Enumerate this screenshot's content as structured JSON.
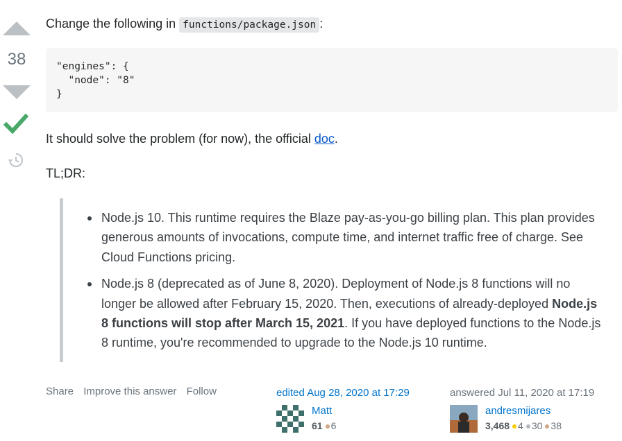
{
  "vote": {
    "score": "38"
  },
  "post": {
    "intro_text": "Change the following in ",
    "intro_code": "functions/package.json",
    "intro_suffix": ":",
    "code_block": "\"engines\": {\n  \"node\": \"8\"\n}",
    "solve_prefix": "It should solve the problem (for now), the official ",
    "solve_link": "doc",
    "solve_suffix": ".",
    "tldr": "TL;DR:",
    "quote_items": [
      {
        "text": "Node.js 10. This runtime requires the Blaze pay-as-you-go billing plan. This plan provides generous amounts of invocations, compute time, and internet traffic free of charge. See Cloud Functions pricing."
      },
      {
        "before": "Node.js 8 (deprecated as of June 8, 2020). Deployment of Node.js 8 functions will no longer be allowed after February 15, 2020. Then, executions of already-deployed ",
        "bold": "Node.js 8 functions will stop after March 15, 2021",
        "after": ". If you have deployed functions to the Node.js 8 runtime, you're recommended to upgrade to the Node.js 10 runtime."
      }
    ]
  },
  "actions": {
    "share": "Share",
    "improve": "Improve this answer",
    "follow": "Follow"
  },
  "editor": {
    "action_time": "edited Aug 28, 2020 at 17:29",
    "name": "Matt",
    "reputation": "61",
    "bronze": "6"
  },
  "answerer": {
    "action_time": "answered Jul 11, 2020 at 17:19",
    "name": "andresmijares",
    "reputation": "3,468",
    "gold": "4",
    "silver": "30",
    "bronze": "38"
  },
  "colors": {
    "accepted": "#48a868",
    "link": "#0a58ca",
    "vote_arrow": "#bbc0c4"
  }
}
